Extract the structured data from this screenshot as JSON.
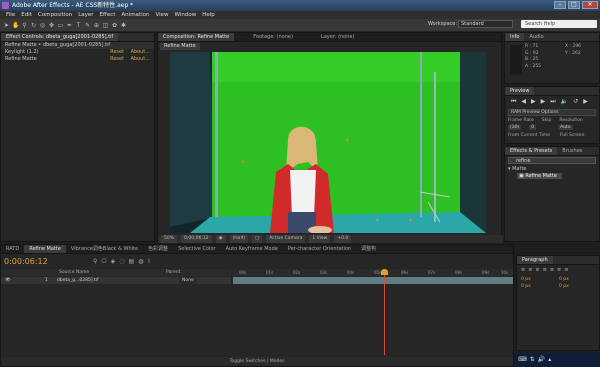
{
  "title": "Adobe After Effects - AE CSS新特性.aep *",
  "menu": [
    "File",
    "Edit",
    "Composition",
    "Layer",
    "Effect",
    "Animation",
    "View",
    "Window",
    "Help"
  ],
  "workspace": {
    "label": "Workspace:",
    "value": "Standard"
  },
  "search": {
    "placeholder": "Search Help"
  },
  "effect_controls": {
    "tab": "Effect Controls: dbeta_guga[2001-0285].tif",
    "breadcrumb": "Refine Matte • dbeta_guga[2001-0285].tif",
    "effects": [
      {
        "name": "Keylight (1.2)",
        "reset": "Reset",
        "about": "About..."
      },
      {
        "name": "Refine Matte",
        "reset": "Reset",
        "about": "About..."
      }
    ]
  },
  "composition": {
    "tabs": [
      "Composition: Refine Matte",
      "Footage: (none)",
      "Layer: (none)"
    ],
    "viewer_label": "Refine Matte",
    "bottom": {
      "zoom": "50%",
      "time": "0;00;06;12",
      "resolution": "(Half)",
      "camera": "Active Camera",
      "view": "1 View",
      "offset": "+0.0"
    }
  },
  "info": {
    "tabs": [
      "Info",
      "Audio"
    ],
    "r": "R : 71",
    "g": "G : 92",
    "b": "B : 25",
    "a": "A : 255",
    "x": "X : 296",
    "y": "Y : 262"
  },
  "preview": {
    "tab": "Preview",
    "option": "RAM Preview Options",
    "frame_rate_label": "Frame Rate",
    "skip_label": "Skip",
    "resolution_label": "Resolution",
    "frame_rate": "(30)",
    "skip": "0",
    "resolution": "Auto",
    "from_current": "From Current Time",
    "full_screen": "Full Screen"
  },
  "effects_presets": {
    "tabs": [
      "Effects & Presets",
      "Brushes"
    ],
    "search": "refine",
    "category": "Matte",
    "item": "Refine Matte"
  },
  "timeline": {
    "tabs": [
      "RATD",
      "Refine Matte",
      "Vibrance调色Black & White",
      "色彩调整",
      "Selective Color",
      "Auto Keyframe Mode",
      "Per-character Orientation",
      "调整构"
    ],
    "timecode": "0:00:06:12",
    "columns": {
      "source": "Source Name",
      "parent": "Parent"
    },
    "layer": {
      "num": "1",
      "name": "dbeta_g...0285].tif",
      "parent": "None"
    },
    "ticks": [
      "00s",
      "01s",
      "02s",
      "03s",
      "04s",
      "05s",
      "06s",
      "07s",
      "08s",
      "09s",
      "10s"
    ],
    "footer": "Toggle Switches / Modes"
  },
  "paragraph": {
    "tab": "Paragraph",
    "v1": "0 px",
    "v2": "0 px",
    "v3": "0 px",
    "v4": "0 px"
  }
}
